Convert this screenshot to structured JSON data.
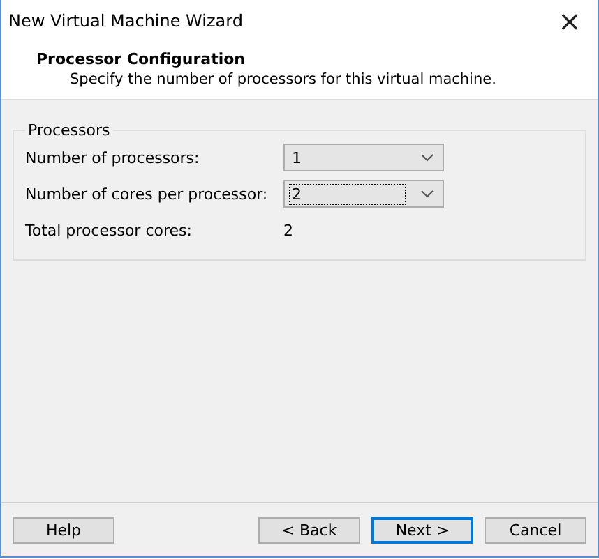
{
  "window": {
    "title": "New Virtual Machine Wizard",
    "close": "×"
  },
  "header": {
    "title": "Processor Configuration",
    "subtitle": "Specify the number of processors for this virtual machine."
  },
  "group": {
    "title": "Processors",
    "rows": [
      {
        "kind": "select",
        "label": "Number of processors:",
        "value": "1",
        "focused": false
      },
      {
        "kind": "select",
        "label": "Number of cores per processor:",
        "value": "2",
        "focused": true
      },
      {
        "kind": "text",
        "label": "Total processor cores:",
        "value": "2"
      }
    ]
  },
  "buttons": [
    {
      "label": "Help",
      "default": false
    },
    {
      "label": "< Back",
      "default": false
    },
    {
      "label": "Next >",
      "default": true
    },
    {
      "label": "Cancel",
      "default": false
    }
  ]
}
